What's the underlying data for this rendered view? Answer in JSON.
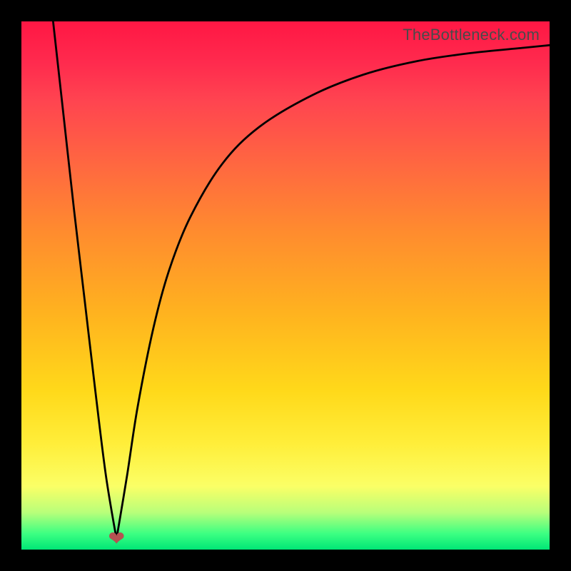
{
  "watermark": "TheBottleneck.com",
  "colors": {
    "frame": "#000000",
    "curve": "#000000",
    "heart": "#b65252",
    "gradient_top": "#ff1744",
    "gradient_mid": "#ffd91a",
    "gradient_bottom": "#00e676"
  },
  "chart_data": {
    "type": "line",
    "title": "",
    "xlabel": "",
    "ylabel": "",
    "xlim": [
      0,
      100
    ],
    "ylim": [
      0,
      100
    ],
    "grid": false,
    "legend": false,
    "annotations": [
      {
        "type": "heart-marker",
        "x": 18,
        "y": 2
      }
    ],
    "series": [
      {
        "name": "left-branch",
        "x": [
          6,
          8,
          10,
          12,
          14,
          16,
          18
        ],
        "y": [
          100,
          82,
          64,
          47,
          30,
          14,
          2
        ]
      },
      {
        "name": "right-branch",
        "x": [
          18,
          20,
          22,
          25,
          28,
          32,
          38,
          45,
          55,
          65,
          75,
          85,
          95,
          100
        ],
        "y": [
          2,
          14,
          27,
          42,
          53,
          63,
          73,
          80,
          86,
          90,
          92.5,
          94,
          95,
          95.5
        ]
      }
    ]
  }
}
